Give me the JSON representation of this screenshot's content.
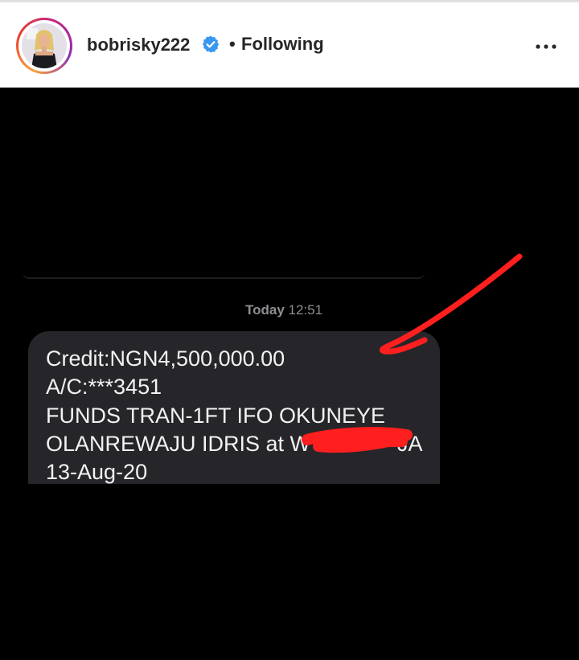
{
  "header": {
    "username": "bobrisky222",
    "separator": "•",
    "follow_status": "Following"
  },
  "message": {
    "time_day": "Today",
    "time_clock": "12:51",
    "lines": [
      "Credit:NGN4,500,000.00",
      "A/C:***3451",
      "FUNDS TRAN-1FT IFO OKUNEYE",
      "OLANREWAJU IDRIS at W",
      "13-Aug-20"
    ],
    "line4_tail": "JA"
  },
  "colors": {
    "verified_badge": "#3897f0",
    "annotation": "#ff1f1f",
    "bubble": "#26262a"
  },
  "icons": [
    "verified-badge-icon",
    "more-options-icon"
  ]
}
